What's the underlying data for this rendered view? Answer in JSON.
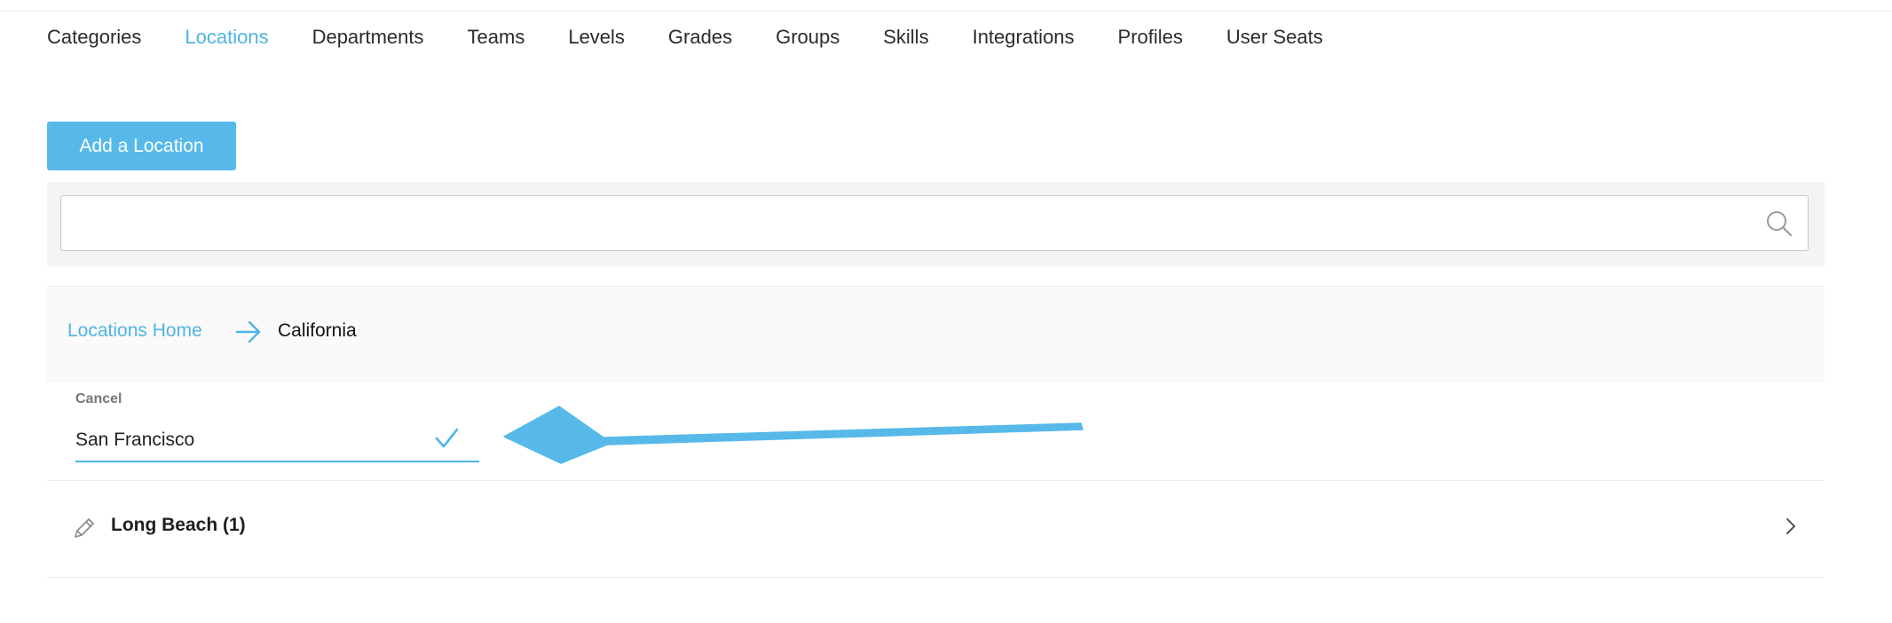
{
  "nav": {
    "tabs": [
      {
        "label": "Categories"
      },
      {
        "label": "Locations"
      },
      {
        "label": "Departments"
      },
      {
        "label": "Teams"
      },
      {
        "label": "Levels"
      },
      {
        "label": "Grades"
      },
      {
        "label": "Groups"
      },
      {
        "label": "Skills"
      },
      {
        "label": "Integrations"
      },
      {
        "label": "Profiles"
      },
      {
        "label": "User Seats"
      }
    ],
    "active_tab": "Locations"
  },
  "actions": {
    "add_label": "Add a Location"
  },
  "search": {
    "value": "",
    "placeholder": "",
    "icon": "search-icon"
  },
  "breadcrumb": {
    "home": "Locations Home",
    "separator_icon": "arrow-right-icon",
    "current": "California"
  },
  "edit": {
    "cancel_label": "Cancel",
    "value": "San Francisco",
    "confirm_icon": "checkmark-icon"
  },
  "list": {
    "items": [
      {
        "label": "Long Beach (1)",
        "edit_icon": "pencil-icon",
        "nav_icon": "chevron-right-icon"
      }
    ]
  },
  "colors": {
    "accent": "#57b9ea",
    "link": "#4fb4e4",
    "annotation_arrow": "#57b9ea"
  }
}
